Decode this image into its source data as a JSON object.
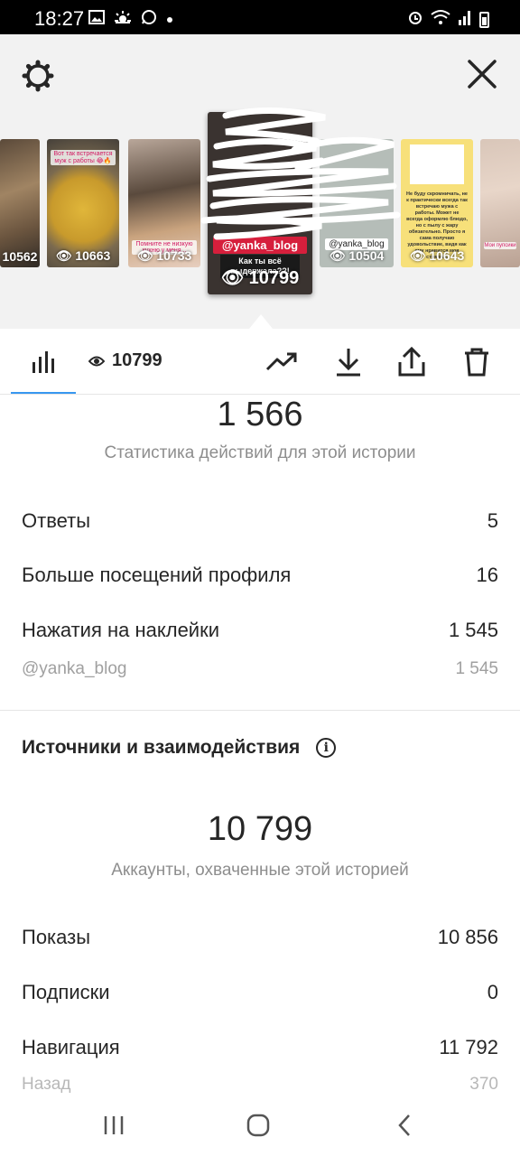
{
  "status_bar": {
    "time": "18:27",
    "left_icons": [
      "gallery-icon",
      "weather-icon",
      "whatsapp-icon",
      "dot-icon"
    ],
    "right_icons": [
      "alarm-icon",
      "wifi-icon",
      "signal-icon",
      "battery-icon"
    ]
  },
  "stories": [
    {
      "count": "10562",
      "caption": ""
    },
    {
      "count": "10663",
      "caption": "Вот так встречается муж с работы 😂🔥"
    },
    {
      "count": "10733",
      "caption": "Помните не низкую кухню у меня..."
    },
    {
      "count": "10799",
      "tag": "@yanka_blog",
      "question": "Как ты всё выдержала??!"
    },
    {
      "count": "10504",
      "tag": "@yanka_blog"
    },
    {
      "count": "10643",
      "note": "Не буду скромничать, не к практически всегда так встречаю мужа с работы. Может не всегда оформлю блюдо, но с пылу с жару обязательно. Просто я сама получаю удовольствие, видя как ему нравится моя стряпня."
    },
    {
      "count": "",
      "caption": "Мои пупсики"
    }
  ],
  "toolbar": {
    "views": "10799",
    "icons": [
      "bar-chart-icon",
      "eye-icon",
      "trending-icon",
      "download-icon",
      "share-icon",
      "trash-icon"
    ]
  },
  "actions": {
    "total": "1 566",
    "caption": "Статистика действий для этой истории",
    "rows": [
      {
        "label": "Ответы",
        "value": "5"
      },
      {
        "label": "Больше посещений профиля",
        "value": "16"
      },
      {
        "label": "Нажатия на наклейки",
        "value": "1 545"
      }
    ],
    "sub_row": {
      "label": "@yanka_blog",
      "value": "1 545"
    }
  },
  "sources": {
    "title": "Источники и взаимодействия",
    "total": "10 799",
    "caption": "Аккаунты, охваченные этой историей",
    "rows": [
      {
        "label": "Показы",
        "value": "10 856"
      },
      {
        "label": "Подписки",
        "value": "0"
      },
      {
        "label": "Навигация",
        "value": "11 792"
      }
    ],
    "faded_row": {
      "label": "Назад",
      "value": "370"
    }
  },
  "nav": {
    "icons": [
      "recents-icon",
      "home-icon",
      "back-icon"
    ]
  }
}
